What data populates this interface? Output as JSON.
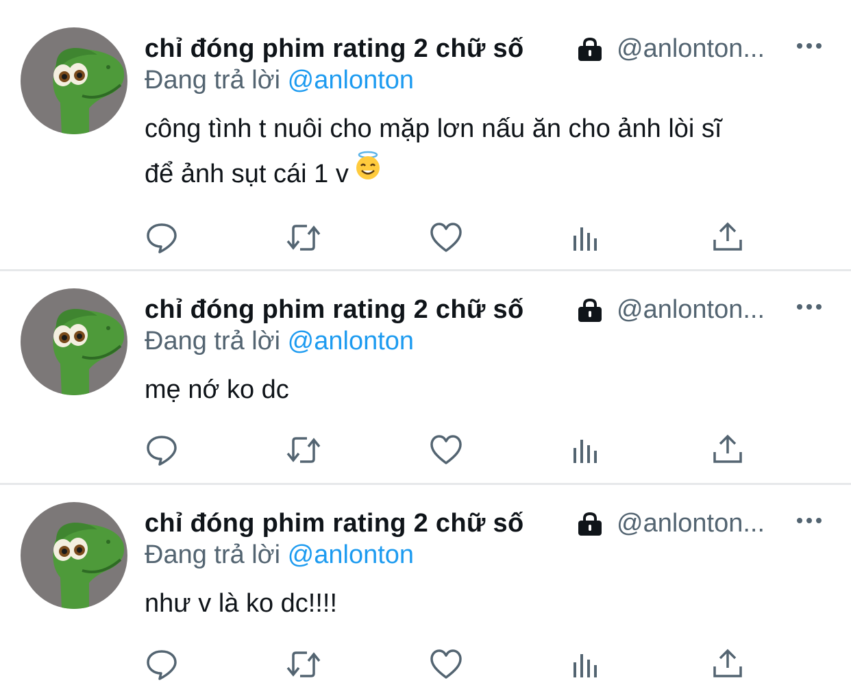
{
  "tweets": [
    {
      "display_name": "chỉ đóng phim rating 2 chữ số",
      "handle": "@anlonton...",
      "reply_prefix": "Đang trả lời",
      "reply_to": "@anlonton",
      "body_lines": [
        "công tình t nuôi cho mặp lơn nấu ăn cho ảnh lòi sĩ",
        "để ảnh sụt cái 1 v"
      ],
      "emoji": "smiling-face-with-halo"
    },
    {
      "display_name": "chỉ đóng phim rating 2 chữ số",
      "handle": "@anlonton...",
      "reply_prefix": "Đang trả lời",
      "reply_to": "@anlonton",
      "body_lines": [
        "mẹ nớ ko dc"
      ]
    },
    {
      "display_name": "chỉ đóng phim rating 2 chữ số",
      "handle": "@anlonton...",
      "reply_prefix": "Đang trả lời",
      "reply_to": "@anlonton",
      "body_lines": [
        "như v là ko dc!!!!"
      ]
    }
  ],
  "icons": {
    "lock": "lock-icon",
    "more": "more-icon",
    "actions": [
      "reply-icon",
      "retweet-icon",
      "like-icon",
      "views-icon",
      "share-icon"
    ]
  },
  "colors": {
    "text": "#0f1419",
    "secondary": "#536471",
    "link": "#1d9bf0",
    "divider": "#e6e8ea"
  }
}
